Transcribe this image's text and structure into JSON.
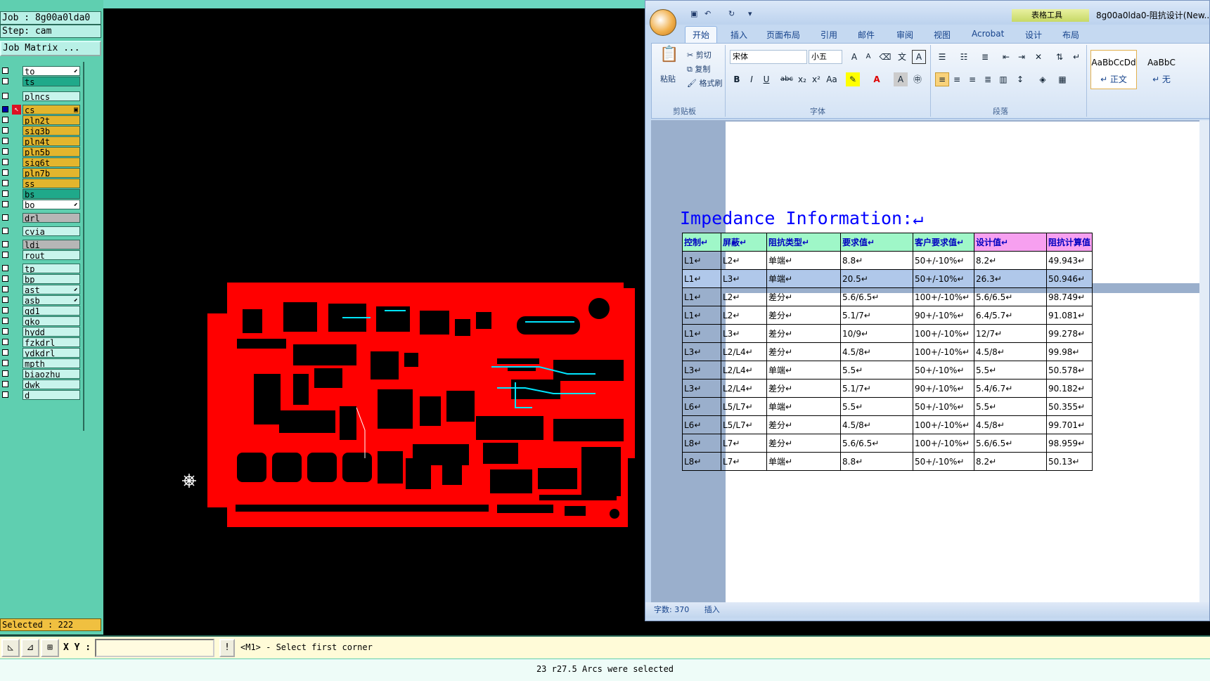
{
  "cam": {
    "job": "Job : 8g00a0lda0",
    "step": "Step: cam",
    "matrix_button": "Job Matrix ...",
    "selected": "Selected : 222",
    "colors": {
      "signal_active": "#ff0000",
      "panel_bg": "#5fcfb0",
      "layer_yellow": "#e3b52d",
      "layer_teal": "#1fa98a",
      "layer_gray": "#b6b6b6",
      "layer_light": "#c8f4ec",
      "layer_white": "#ffffff"
    },
    "layers": [
      {
        "name": "to",
        "color": "#ffffff",
        "mark": "⬋"
      },
      {
        "name": "ts",
        "color": "#1fa98a",
        "mark": ""
      },
      {
        "name": "plncs",
        "color": "#c8f4ec",
        "mark": ""
      },
      {
        "name": "cs",
        "color": "#e3b52d",
        "mark": "▣",
        "active": true
      },
      {
        "name": "pln2t",
        "color": "#e3b52d",
        "mark": ""
      },
      {
        "name": "sig3b",
        "color": "#e3b52d",
        "mark": ""
      },
      {
        "name": "pln4t",
        "color": "#e3b52d",
        "mark": ""
      },
      {
        "name": "pln5b",
        "color": "#e3b52d",
        "mark": ""
      },
      {
        "name": "sig6t",
        "color": "#e3b52d",
        "mark": ""
      },
      {
        "name": "pln7b",
        "color": "#e3b52d",
        "mark": ""
      },
      {
        "name": "ss",
        "color": "#e3b52d",
        "mark": ""
      },
      {
        "name": "bs",
        "color": "#1fa98a",
        "mark": ""
      },
      {
        "name": "bo",
        "color": "#ffffff",
        "mark": "⬋"
      },
      {
        "name": "drl",
        "color": "#b6b6b6",
        "mark": ""
      },
      {
        "name": "cvia",
        "color": "#c8f4ec",
        "mark": ""
      },
      {
        "name": "ldi",
        "color": "#b6b6b6",
        "mark": ""
      },
      {
        "name": "rout",
        "color": "#c8f4ec",
        "mark": ""
      },
      {
        "name": "tp",
        "color": "#c8f4ec",
        "mark": ""
      },
      {
        "name": "bp",
        "color": "#c8f4ec",
        "mark": ""
      },
      {
        "name": "ast",
        "color": "#c8f4ec",
        "mark": "⬋"
      },
      {
        "name": "asb",
        "color": "#c8f4ec",
        "mark": "⬋"
      },
      {
        "name": "gd1",
        "color": "#c8f4ec",
        "mark": ""
      },
      {
        "name": "gko",
        "color": "#c8f4ec",
        "mark": ""
      },
      {
        "name": "hydd",
        "color": "#c8f4ec",
        "mark": ""
      },
      {
        "name": "fzkdrl",
        "color": "#c8f4ec",
        "mark": ""
      },
      {
        "name": "ydkdrl",
        "color": "#c8f4ec",
        "mark": ""
      },
      {
        "name": "mpth",
        "color": "#c8f4ec",
        "mark": ""
      },
      {
        "name": "biaozhu",
        "color": "#c8f4ec",
        "mark": ""
      },
      {
        "name": "dwk",
        "color": "#c8f4ec",
        "mark": ""
      },
      {
        "name": "d",
        "color": "#c8f4ec",
        "mark": ""
      }
    ],
    "xy_label": "X Y :",
    "xy_value": "",
    "prompt": "<M1> - Select first corner",
    "status": "23 r27.5 Arcs were selected"
  },
  "word": {
    "context_tab": "表格工具",
    "doc_title": "8g00a0lda0-阻抗设计(New...",
    "tabs": [
      "开始",
      "插入",
      "页面布局",
      "引用",
      "邮件",
      "审阅",
      "视图",
      "Acrobat",
      "设计",
      "布局"
    ],
    "clipboard": {
      "paste": "粘贴",
      "cut": "剪切",
      "copy": "复制",
      "format_painter": "格式刷",
      "label": "剪贴板"
    },
    "font": {
      "name": "宋体",
      "size": "小五",
      "label": "字体"
    },
    "paragraph_label": "段落",
    "styles": [
      {
        "preview": "AaBbCcDd",
        "name": "↵ 正文"
      },
      {
        "preview": "AaBbC",
        "name": "↵ 无"
      }
    ],
    "status": {
      "word_count": "字数: 370",
      "mode": "插入"
    },
    "impedance_title": "Impedance Information:↵",
    "table_headers": [
      "控制↵",
      "屏蔽↵",
      "阻抗类型↵",
      "要求值↵",
      "客户要求值↵",
      "设计值↵",
      "阻抗计算值"
    ],
    "table_header_colors": [
      "#9ff7c8",
      "#9ff7c8",
      "#9ff7c8",
      "#9ff7c8",
      "#9ff7c8",
      "#f7a0f0",
      "#f7a0f0"
    ],
    "table_rows": [
      [
        "L1↵",
        "L2↵",
        "单端↵",
        "8.8↵",
        "50+/-10%↵",
        "8.2↵",
        "49.943↵"
      ],
      [
        "L1↵",
        "L3↵",
        "单端↵",
        "20.5↵",
        "50+/-10%↵",
        "26.3↵",
        "50.946↵"
      ],
      [
        "L1↵",
        "L2↵",
        "差分↵",
        "5.6/6.5↵",
        "100+/-10%↵",
        "5.6/6.5↵",
        "98.749↵"
      ],
      [
        "L1↵",
        "L2↵",
        "差分↵",
        "5.1/7↵",
        "90+/-10%↵",
        "6.4/5.7↵",
        "91.081↵"
      ],
      [
        "L1↵",
        "L3↵",
        "差分↵",
        "10/9↵",
        "100+/-10%↵",
        "12/7↵",
        "99.278↵"
      ],
      [
        "L3↵",
        "L2/L4↵",
        "差分↵",
        "4.5/8↵",
        "100+/-10%↵",
        "4.5/8↵",
        "99.98↵"
      ],
      [
        "L3↵",
        "L2/L4↵",
        "单端↵",
        "5.5↵",
        "50+/-10%↵",
        "5.5↵",
        "50.578↵"
      ],
      [
        "L3↵",
        "L2/L4↵",
        "差分↵",
        "5.1/7↵",
        "90+/-10%↵",
        "5.4/6.7↵",
        "90.182↵"
      ],
      [
        "L6↵",
        "L5/L7↵",
        "单端↵",
        "5.5↵",
        "50+/-10%↵",
        "5.5↵",
        "50.355↵"
      ],
      [
        "L6↵",
        "L5/L7↵",
        "差分↵",
        "4.5/8↵",
        "100+/-10%↵",
        "4.5/8↵",
        "99.701↵"
      ],
      [
        "L8↵",
        "L7↵",
        "差分↵",
        "5.6/6.5↵",
        "100+/-10%↵",
        "5.6/6.5↵",
        "98.959↵"
      ],
      [
        "L8↵",
        "L7↵",
        "单端↵",
        "8.8↵",
        "50+/-10%↵",
        "8.2↵",
        "50.13↵"
      ]
    ],
    "highlighted_row": 1
  }
}
